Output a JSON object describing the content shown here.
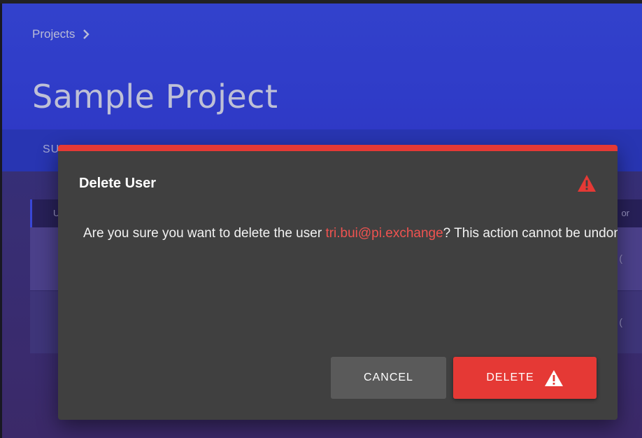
{
  "breadcrumb": {
    "label": "Projects",
    "icon": "chevron-right-icon"
  },
  "page": {
    "title": "Sample Project"
  },
  "tabs": [
    {
      "label": "SU"
    }
  ],
  "table": {
    "headers": {
      "first": "U",
      "last": "or"
    },
    "row_icon": "("
  },
  "dialog": {
    "title": "Delete User",
    "warning_icon": "warning-triangle-icon",
    "message_prefix": "Are you sure you want to delete the user ",
    "email": "tri.bui@pi.exchange",
    "message_suffix": "? This action cannot be undone.",
    "cancel_label": "CANCEL",
    "delete_label": "DELETE",
    "accent_color": "#e53935"
  }
}
